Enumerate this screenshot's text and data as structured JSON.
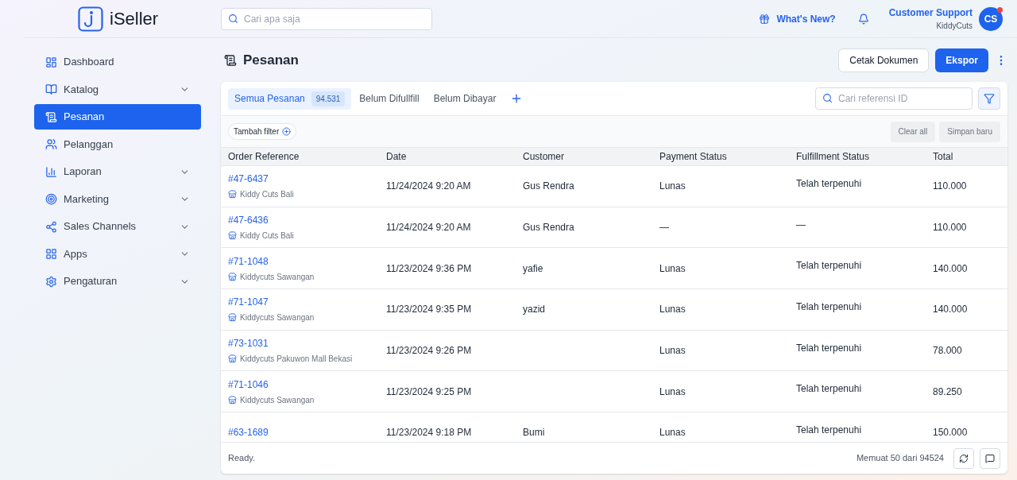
{
  "brand": {
    "name": "iSeller"
  },
  "search": {
    "placeholder": "Cari apa saja"
  },
  "header": {
    "whats_new": "What's New?",
    "user_name": "Customer Support",
    "store": "KiddyCuts",
    "avatar_initials": "CS",
    "notification": true
  },
  "sidebar": {
    "items": [
      {
        "label": "Dashboard",
        "selected": false,
        "expandable": false
      },
      {
        "label": "Katalog",
        "selected": false,
        "expandable": true
      },
      {
        "label": "Pesanan",
        "selected": true,
        "expandable": false
      },
      {
        "label": "Pelanggan",
        "selected": false,
        "expandable": false
      },
      {
        "label": "Laporan",
        "selected": false,
        "expandable": true
      },
      {
        "label": "Marketing",
        "selected": false,
        "expandable": true
      },
      {
        "label": "Sales Channels",
        "selected": false,
        "expandable": true
      },
      {
        "label": "Apps",
        "selected": false,
        "expandable": true
      },
      {
        "label": "Pengaturan",
        "selected": false,
        "expandable": true
      }
    ]
  },
  "page": {
    "title": "Pesanan",
    "buttons": [
      {
        "label": "Cetak Dokumen",
        "kind": "secondary"
      },
      {
        "label": "Ekspor",
        "kind": "primary"
      }
    ]
  },
  "tabs": [
    {
      "label": "Semua Pesanan",
      "count": "94.531",
      "selected": true
    },
    {
      "label": "Belum Difullfill",
      "selected": false
    },
    {
      "label": "Belum Dibayar",
      "selected": false
    }
  ],
  "reference_search": {
    "placeholder": "Cari referensi ID"
  },
  "filter_bar": {
    "add_filter": "Tambah filter",
    "clear_all": "Clear all",
    "save_new": "Simpan baru"
  },
  "table": {
    "columns": [
      "Order Reference",
      "Date",
      "Customer",
      "Payment Status",
      "Fulfillment Status",
      "Total"
    ],
    "rows": [
      {
        "reference": "#47-6437",
        "store": "Kiddy Cuts Bali",
        "date": "11/24/2024 9:20 AM",
        "customer": "Gus Rendra",
        "payment": "Lunas",
        "fulfillment": "Telah terpenuhi",
        "total": "110.000"
      },
      {
        "reference": "#47-6436",
        "store": "Kiddy Cuts Bali",
        "date": "11/24/2024 9:20 AM",
        "customer": "Gus Rendra",
        "payment": "—",
        "fulfillment": "—",
        "total": "110.000"
      },
      {
        "reference": "#71-1048",
        "store": "Kiddycuts Sawangan",
        "date": "11/23/2024 9:36 PM",
        "customer": "yafie",
        "payment": "Lunas",
        "fulfillment": "Telah terpenuhi",
        "total": "140.000"
      },
      {
        "reference": "#71-1047",
        "store": "Kiddycuts Sawangan",
        "date": "11/23/2024 9:35 PM",
        "customer": "yazid",
        "payment": "Lunas",
        "fulfillment": "Telah terpenuhi",
        "total": "140.000"
      },
      {
        "reference": "#73-1031",
        "store": "Kiddycuts Pakuwon Mall Bekasi",
        "date": "11/23/2024 9:26 PM",
        "payment": "Lunas",
        "fulfillment": "Telah terpenuhi",
        "total": "78.000"
      },
      {
        "reference": "#71-1046",
        "store": "Kiddycuts Sawangan",
        "date": "11/23/2024 9:25 PM",
        "payment": "Lunas",
        "fulfillment": "Telah terpenuhi",
        "total": "89.250"
      },
      {
        "reference": "#63-1689",
        "date": "11/23/2024 9:18 PM",
        "customer": "Bumi",
        "payment": "Lunas",
        "fulfillment": "Telah terpenuhi",
        "total": "150.000"
      }
    ]
  },
  "status_bar": {
    "status": "Ready.",
    "loaded": "Memuat 50 dari 94524"
  }
}
